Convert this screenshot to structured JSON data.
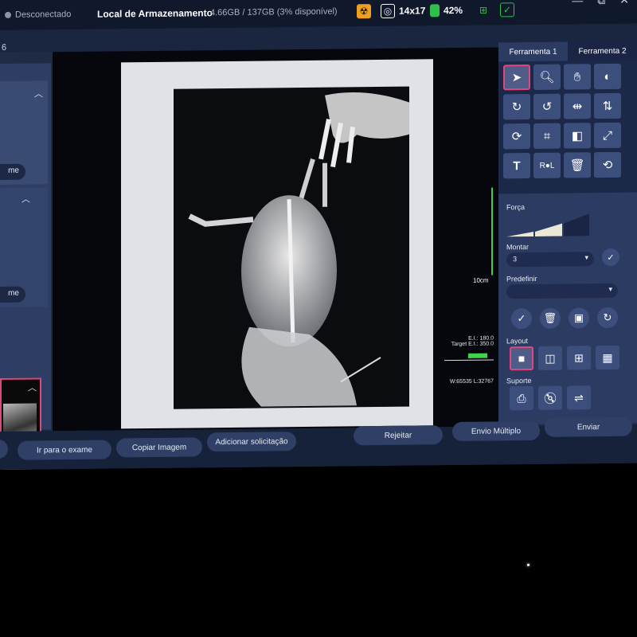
{
  "topbar": {
    "connection_status": "Desconectado",
    "storage_label": "Local de Armazenamento",
    "storage_value": "4.66GB / 137GB (3% disponível)",
    "film_size": "14x17",
    "battery": "42%"
  },
  "subbar": {
    "fragment": "6"
  },
  "leftpanel": {
    "pill_1": "me",
    "pill_2": "me"
  },
  "viewer": {
    "scale_label": "10cm",
    "ei": "E.I.: 180.0",
    "target_ei": "Target E.I.: 350.0",
    "window_level": "W:65535 L:32767"
  },
  "rightpanel": {
    "tabs": [
      "Ferramenta 1",
      "Ferramenta 2"
    ],
    "forca_label": "Força",
    "montar_label": "Montar",
    "montar_value": "3",
    "predefinir_label": "Predefinir",
    "predefinir_value": "",
    "layout_label": "Layout",
    "suporte_label": "Suporte",
    "tools": [
      "select-arrow-icon",
      "zoom-icon",
      "pan-hand-icon",
      "contrast-icon",
      "rotate-right-icon",
      "rotate-left-icon",
      "flip-horizontal-icon",
      "flip-vertical-icon",
      "rotate-360-icon",
      "crop-icon",
      "invert-icon",
      "fit-screen-icon",
      "text-icon",
      "marker-rl-icon",
      "delete-icon",
      "reset-icon"
    ]
  },
  "bottombar": {
    "ir_para_exame": "Ir para o exame",
    "copiar_imagem": "Copiar Imagem",
    "adicionar_solicitacao": "Adicionar solicitação",
    "rejeitar": "Rejeitar",
    "envio_multiplo": "Envio Múltiplo",
    "enviar": "Enviar"
  }
}
